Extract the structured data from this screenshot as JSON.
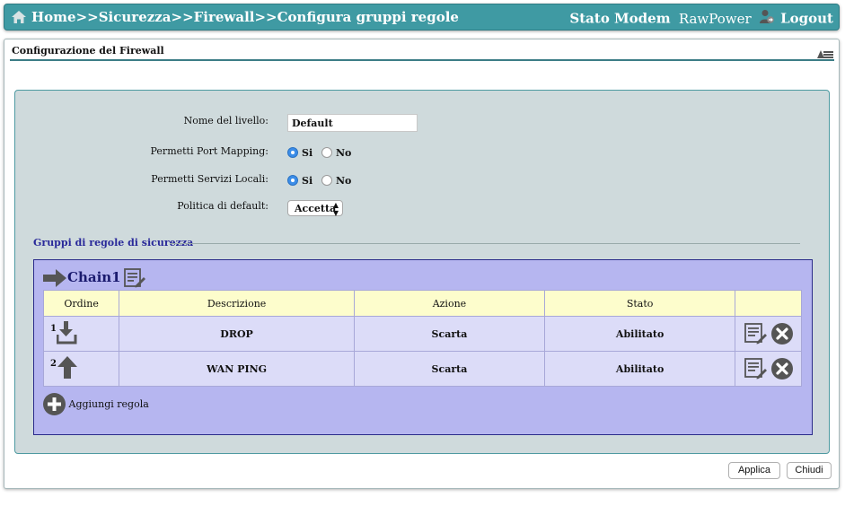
{
  "header": {
    "breadcrumb": "Home>>Sicurezza>>Firewall>>Configura gruppi regole",
    "status_link": "Stato Modem",
    "user": "RawPower",
    "logout": "Logout",
    "bar_color": "#3f9aa3"
  },
  "panel": {
    "title": "Configurazione del Firewall"
  },
  "form": {
    "level_name_label": "Nome del livello:",
    "level_name_value": "Default",
    "port_mapping_label": "Permetti Port Mapping:",
    "port_mapping_options": [
      "Si",
      "No"
    ],
    "port_mapping_selected": "Si",
    "local_services_label": "Permetti Servizi Locali:",
    "local_services_options": [
      "Si",
      "No"
    ],
    "local_services_selected": "Si",
    "default_policy_label": "Politica di default:",
    "default_policy_value": "Accetta"
  },
  "groups": {
    "section_title": "Gruppi di regole di sicurezza",
    "chain_name": "Chain1",
    "columns": [
      "Ordine",
      "Descrizione",
      "Azione",
      "Stato",
      ""
    ],
    "rows": [
      {
        "order": "1",
        "order_icon": "move-down-icon",
        "description": "DROP",
        "action": "Scarta",
        "state": "Abilitato"
      },
      {
        "order": "2",
        "order_icon": "move-up-icon",
        "description": "WAN PING",
        "action": "Scarta",
        "state": "Abilitato"
      }
    ],
    "add_rule": "Aggiungi regola",
    "chain_color": "#b6b6f0",
    "header_color": "#fdfdcc"
  },
  "buttons": {
    "apply": "Applica",
    "close": "Chiudi"
  }
}
